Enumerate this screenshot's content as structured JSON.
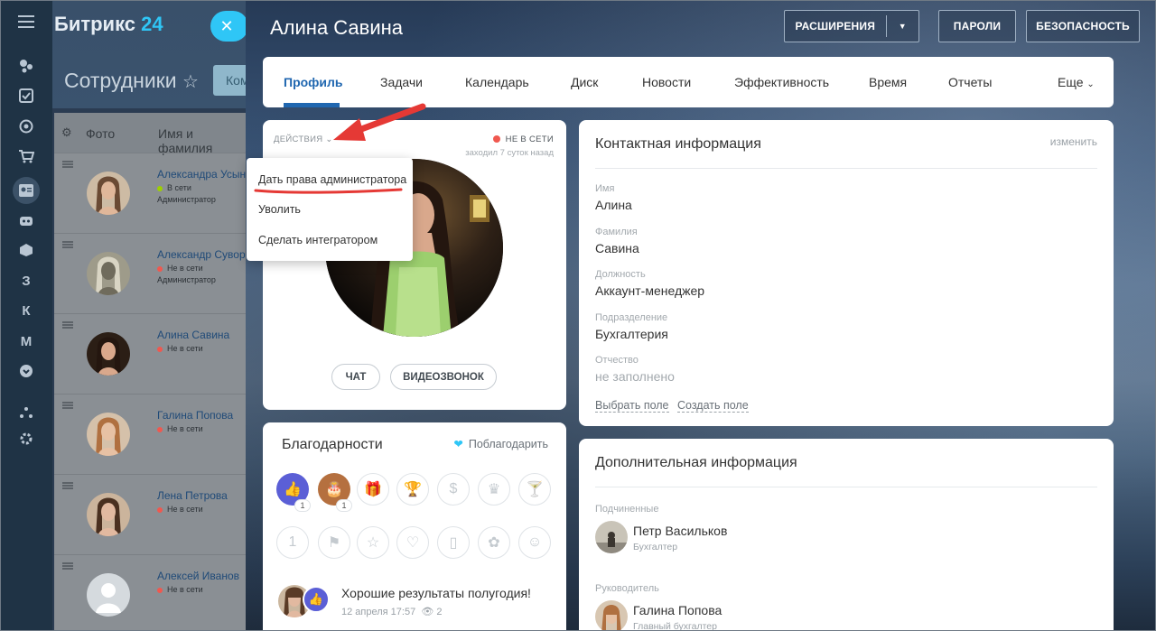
{
  "app": {
    "logo_text": "Битрикс",
    "logo_num": "24",
    "page_title": "Сотрудники",
    "filter_stub": "Ком",
    "left_icons": [
      "menu-icon",
      "activity-icon",
      "tasks-icon",
      "target-icon",
      "cart-icon",
      "contacts-icon",
      "robot-icon",
      "box-icon",
      "З",
      "К",
      "М",
      "chevron-circle-icon",
      "sitemap-icon",
      "settings-icon"
    ]
  },
  "employees": {
    "columns": [
      "Фото",
      "Имя и фамилия"
    ],
    "rows": [
      {
        "name": "Александра Усынина",
        "status": "В сети",
        "status_color": "#9dcf00",
        "position": "Администратор"
      },
      {
        "name": "Александр Суворов",
        "status": "Не в сети",
        "status_color": "#f0584f",
        "position": "Администратор"
      },
      {
        "name": "Алина Савина",
        "status": "Не в сети",
        "status_color": "#f0584f",
        "position": ""
      },
      {
        "name": "Галина Попова",
        "status": "Не в сети",
        "status_color": "#f0584f",
        "position": ""
      },
      {
        "name": "Лена Петрова",
        "status": "Не в сети",
        "status_color": "#f0584f",
        "position": ""
      },
      {
        "name": "Алексей Иванов",
        "status": "Не в сети",
        "status_color": "#f0584f",
        "position": ""
      }
    ]
  },
  "profile": {
    "user_name": "Алина Савина",
    "header_buttons": {
      "extensions": "РАСШИРЕНИЯ",
      "passwords": "ПАРОЛИ",
      "security": "БЕЗОПАСНОСТЬ"
    },
    "tabs": [
      "Профиль",
      "Задачи",
      "Календарь",
      "Диск",
      "Новости",
      "Эффективность",
      "Время",
      "Отчеты",
      "Еще"
    ],
    "active_tab": "Профиль",
    "actions_label": "ДЕЙСТВИЯ",
    "presence": "НЕ В СЕТИ",
    "last_seen": "заходил 7 суток назад",
    "chat_button": "ЧАТ",
    "video_button": "ВИДЕОЗВОНОК",
    "menu_items": [
      "Дать права администратора",
      "Уволить",
      "Сделать интегратором"
    ]
  },
  "contact": {
    "title": "Контактная информация",
    "edit": "изменить",
    "fields": [
      {
        "label": "Имя",
        "value": "Алина"
      },
      {
        "label": "Фамилия",
        "value": "Савина"
      },
      {
        "label": "Должность",
        "value": "Аккаунт-менеджер"
      },
      {
        "label": "Подразделение",
        "value": "Бухгалтерия"
      },
      {
        "label": "Отчество",
        "value": "не заполнено"
      }
    ],
    "select_field": "Выбрать поле",
    "create_field": "Создать поле"
  },
  "thanks": {
    "title": "Благодарности",
    "button": "Поблагодарить",
    "badges_row1": [
      "like-icon",
      "cake-icon",
      "gift-icon",
      "cup-icon",
      "money-icon",
      "crown-icon",
      "cocktail-icon"
    ],
    "badges_row2": [
      "one-icon",
      "flag-icon",
      "star-icon",
      "heart-icon",
      "beer-icon",
      "flower-icon",
      "smile-icon"
    ],
    "badge_counts": [
      "1",
      "1"
    ],
    "post_title": "Хорошие результаты полугодия!",
    "post_date": "12 апреля 17:57",
    "post_views": "2"
  },
  "extra": {
    "title": "Дополнительная информация",
    "subordinates_label": "Подчиненные",
    "subordinate": {
      "name": "Петр Васильков",
      "position": "Бухгалтер"
    },
    "manager_label": "Руководитель",
    "manager": {
      "name": "Галина Попова",
      "position": "Главный бухгалтер"
    }
  },
  "colors": {
    "accent": "#2067b0",
    "brand": "#2fc6f6",
    "offline": "#f0584f",
    "online": "#9dcf00",
    "annotation": "#e53935"
  }
}
